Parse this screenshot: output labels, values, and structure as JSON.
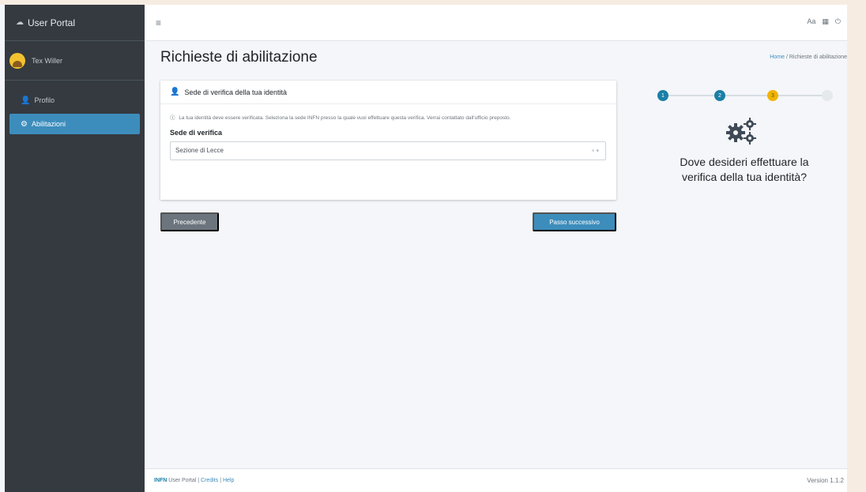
{
  "app": {
    "brand_icon": "cloud-icon",
    "title": "User Portal"
  },
  "user": {
    "name": "Tex Willer",
    "avatar_color": "#f2c230"
  },
  "sidebar": {
    "items": [
      {
        "label": "Profilo",
        "icon": "user-icon",
        "active": false
      },
      {
        "label": "Abilitazioni",
        "icon": "cogs-icon",
        "active": true
      }
    ]
  },
  "navbar": {
    "menu_icon": "hamburger-icon",
    "right_items": [
      "Aa",
      "grid-icon",
      "power-icon"
    ],
    "right_text": "Aa"
  },
  "page": {
    "title": "Richieste di abilitazione",
    "breadcrumb": {
      "home": "Home",
      "separator": "/",
      "current": "Richieste di abilitazione"
    }
  },
  "card": {
    "header": "Sede di verifica della tua identità",
    "info": "La tua identità deve essere verificata. Seleziona la sede INFN presso la quale vuoi effettuare questa verifica. Verrai contattato dall'ufficio preposto.",
    "field_label": "Sede di verifica",
    "select_value": "Sezione di Lecce",
    "select_clear": "×",
    "select_arrow": "▾"
  },
  "buttons": {
    "prev": "Precedente",
    "next": "Passo successivo"
  },
  "stepper": {
    "steps": [
      "1",
      "2",
      "3",
      ""
    ],
    "current": 3,
    "colors": {
      "done": "#1b7fa6",
      "current": "#f0b400",
      "pending": "#e6e9ec"
    }
  },
  "step_panel": {
    "icon": "cogs-icon",
    "title": "Dove desideri effettuare la verifica della tua identità?"
  },
  "footer": {
    "brand": "INFN",
    "app": "User Portal",
    "sep1": "|",
    "credits": "Credits",
    "sep2": "|",
    "help": "Help",
    "version": "Version 1.1.2"
  },
  "colors": {
    "sidebar_bg": "#343a40",
    "primary": "#3c8dbc",
    "secondary": "#6c757d"
  }
}
